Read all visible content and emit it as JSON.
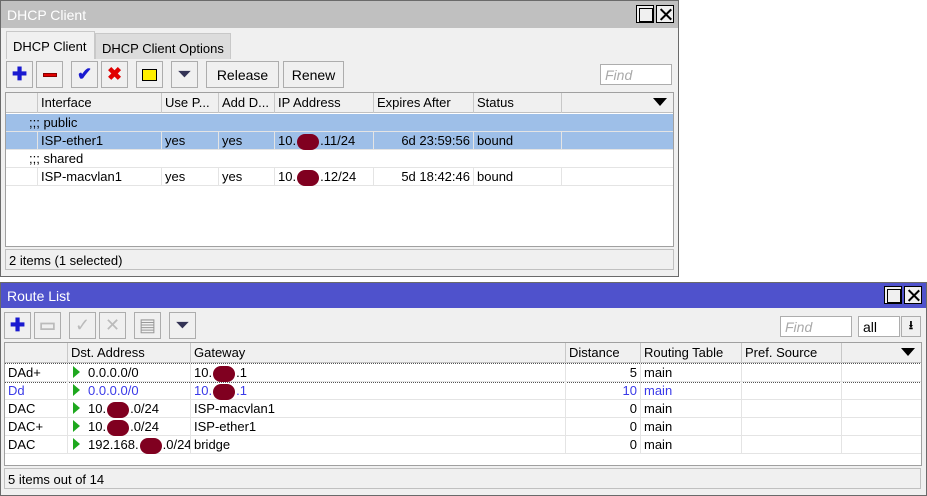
{
  "dhcp": {
    "title": "DHCP Client",
    "tabs": [
      "DHCP Client",
      "DHCP Client Options"
    ],
    "buttons": {
      "release": "Release",
      "renew": "Renew"
    },
    "find_placeholder": "Find",
    "columns": [
      "",
      "Interface",
      "Use P...",
      "Add D...",
      "IP Address",
      "Expires After",
      "Status",
      ""
    ],
    "rows": [
      {
        "type": "comment",
        "text": ";;; public"
      },
      {
        "type": "data",
        "selected": true,
        "cells": [
          "",
          "ISP-ether1",
          "yes",
          "yes",
          {
            "pre": "10.",
            "post": ".11/24"
          },
          "6d 23:59:56",
          "bound",
          ""
        ]
      },
      {
        "type": "comment",
        "text": ";;; shared"
      },
      {
        "type": "data",
        "selected": false,
        "cells": [
          "",
          "ISP-macvlan1",
          "yes",
          "yes",
          {
            "pre": "10.",
            "post": ".12/24"
          },
          "5d 18:42:46",
          "bound",
          ""
        ]
      }
    ],
    "status": "2 items (1 selected)"
  },
  "routes": {
    "title": "Route List",
    "find_placeholder": "Find",
    "filter_value": "all",
    "columns": [
      "",
      "Dst. Address",
      "Gateway",
      "Distance",
      "Routing Table",
      "Pref. Source",
      ""
    ],
    "rows": [
      {
        "color": "#000000",
        "cells": [
          "DAd+",
          "0.0.0.0/0",
          {
            "pre": "10.",
            "post": ".1"
          },
          "5",
          "main",
          "",
          ""
        ]
      },
      {
        "color": "#3a3ae8",
        "cells": [
          "Dd",
          "0.0.0.0/0",
          {
            "pre": "10.",
            "post": ".1"
          },
          "10",
          "main",
          "",
          ""
        ]
      },
      {
        "color": "#000000",
        "cells": [
          "DAC",
          {
            "pre": "10.",
            "post": ".0/24"
          },
          "ISP-macvlan1",
          "0",
          "main",
          "",
          ""
        ]
      },
      {
        "color": "#000000",
        "cells": [
          "DAC+",
          {
            "pre": "10.",
            "post": ".0/24"
          },
          "ISP-ether1",
          "0",
          "main",
          "",
          ""
        ]
      },
      {
        "color": "#000000",
        "cells": [
          "DAC",
          {
            "pre": "192.168.",
            "post": ".0/24"
          },
          "bridge",
          "0",
          "main",
          "",
          ""
        ]
      }
    ],
    "status": "5 items out of 14"
  },
  "colors": {
    "dhcp_title": "#c0c0c0",
    "route_title": "#4f52cc",
    "selected_row": "#9ebfe8",
    "redaction": "#800020"
  }
}
